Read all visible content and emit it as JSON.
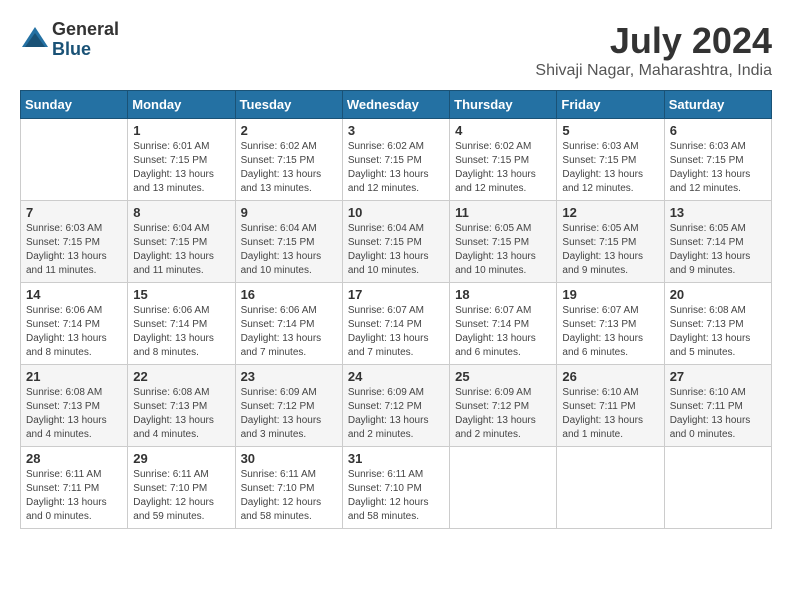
{
  "logo": {
    "general": "General",
    "blue": "Blue"
  },
  "title": {
    "month_year": "July 2024",
    "location": "Shivaji Nagar, Maharashtra, India"
  },
  "days_of_week": [
    "Sunday",
    "Monday",
    "Tuesday",
    "Wednesday",
    "Thursday",
    "Friday",
    "Saturday"
  ],
  "weeks": [
    [
      {
        "day": "",
        "info": ""
      },
      {
        "day": "1",
        "info": "Sunrise: 6:01 AM\nSunset: 7:15 PM\nDaylight: 13 hours\nand 13 minutes."
      },
      {
        "day": "2",
        "info": "Sunrise: 6:02 AM\nSunset: 7:15 PM\nDaylight: 13 hours\nand 13 minutes."
      },
      {
        "day": "3",
        "info": "Sunrise: 6:02 AM\nSunset: 7:15 PM\nDaylight: 13 hours\nand 12 minutes."
      },
      {
        "day": "4",
        "info": "Sunrise: 6:02 AM\nSunset: 7:15 PM\nDaylight: 13 hours\nand 12 minutes."
      },
      {
        "day": "5",
        "info": "Sunrise: 6:03 AM\nSunset: 7:15 PM\nDaylight: 13 hours\nand 12 minutes."
      },
      {
        "day": "6",
        "info": "Sunrise: 6:03 AM\nSunset: 7:15 PM\nDaylight: 13 hours\nand 12 minutes."
      }
    ],
    [
      {
        "day": "7",
        "info": "Sunrise: 6:03 AM\nSunset: 7:15 PM\nDaylight: 13 hours\nand 11 minutes."
      },
      {
        "day": "8",
        "info": "Sunrise: 6:04 AM\nSunset: 7:15 PM\nDaylight: 13 hours\nand 11 minutes."
      },
      {
        "day": "9",
        "info": "Sunrise: 6:04 AM\nSunset: 7:15 PM\nDaylight: 13 hours\nand 10 minutes."
      },
      {
        "day": "10",
        "info": "Sunrise: 6:04 AM\nSunset: 7:15 PM\nDaylight: 13 hours\nand 10 minutes."
      },
      {
        "day": "11",
        "info": "Sunrise: 6:05 AM\nSunset: 7:15 PM\nDaylight: 13 hours\nand 10 minutes."
      },
      {
        "day": "12",
        "info": "Sunrise: 6:05 AM\nSunset: 7:15 PM\nDaylight: 13 hours\nand 9 minutes."
      },
      {
        "day": "13",
        "info": "Sunrise: 6:05 AM\nSunset: 7:14 PM\nDaylight: 13 hours\nand 9 minutes."
      }
    ],
    [
      {
        "day": "14",
        "info": "Sunrise: 6:06 AM\nSunset: 7:14 PM\nDaylight: 13 hours\nand 8 minutes."
      },
      {
        "day": "15",
        "info": "Sunrise: 6:06 AM\nSunset: 7:14 PM\nDaylight: 13 hours\nand 8 minutes."
      },
      {
        "day": "16",
        "info": "Sunrise: 6:06 AM\nSunset: 7:14 PM\nDaylight: 13 hours\nand 7 minutes."
      },
      {
        "day": "17",
        "info": "Sunrise: 6:07 AM\nSunset: 7:14 PM\nDaylight: 13 hours\nand 7 minutes."
      },
      {
        "day": "18",
        "info": "Sunrise: 6:07 AM\nSunset: 7:14 PM\nDaylight: 13 hours\nand 6 minutes."
      },
      {
        "day": "19",
        "info": "Sunrise: 6:07 AM\nSunset: 7:13 PM\nDaylight: 13 hours\nand 6 minutes."
      },
      {
        "day": "20",
        "info": "Sunrise: 6:08 AM\nSunset: 7:13 PM\nDaylight: 13 hours\nand 5 minutes."
      }
    ],
    [
      {
        "day": "21",
        "info": "Sunrise: 6:08 AM\nSunset: 7:13 PM\nDaylight: 13 hours\nand 4 minutes."
      },
      {
        "day": "22",
        "info": "Sunrise: 6:08 AM\nSunset: 7:13 PM\nDaylight: 13 hours\nand 4 minutes."
      },
      {
        "day": "23",
        "info": "Sunrise: 6:09 AM\nSunset: 7:12 PM\nDaylight: 13 hours\nand 3 minutes."
      },
      {
        "day": "24",
        "info": "Sunrise: 6:09 AM\nSunset: 7:12 PM\nDaylight: 13 hours\nand 2 minutes."
      },
      {
        "day": "25",
        "info": "Sunrise: 6:09 AM\nSunset: 7:12 PM\nDaylight: 13 hours\nand 2 minutes."
      },
      {
        "day": "26",
        "info": "Sunrise: 6:10 AM\nSunset: 7:11 PM\nDaylight: 13 hours\nand 1 minute."
      },
      {
        "day": "27",
        "info": "Sunrise: 6:10 AM\nSunset: 7:11 PM\nDaylight: 13 hours\nand 0 minutes."
      }
    ],
    [
      {
        "day": "28",
        "info": "Sunrise: 6:11 AM\nSunset: 7:11 PM\nDaylight: 13 hours\nand 0 minutes."
      },
      {
        "day": "29",
        "info": "Sunrise: 6:11 AM\nSunset: 7:10 PM\nDaylight: 12 hours\nand 59 minutes."
      },
      {
        "day": "30",
        "info": "Sunrise: 6:11 AM\nSunset: 7:10 PM\nDaylight: 12 hours\nand 58 minutes."
      },
      {
        "day": "31",
        "info": "Sunrise: 6:11 AM\nSunset: 7:10 PM\nDaylight: 12 hours\nand 58 minutes."
      },
      {
        "day": "",
        "info": ""
      },
      {
        "day": "",
        "info": ""
      },
      {
        "day": "",
        "info": ""
      }
    ]
  ]
}
